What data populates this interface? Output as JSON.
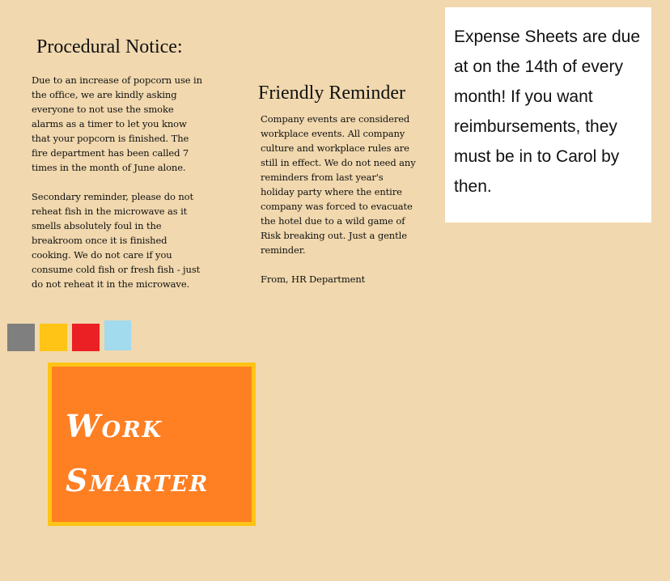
{
  "notice": {
    "title": "Procedural Notice:",
    "paragraphs": [
      "Due to an increase of popcorn use in\nthe office, we are kindly asking\neveryone to not use the smoke\nalarms as a timer to let you know\nthat your popcorn is finished. The\nfire department has been called 7\ntimes in the month of June alone.",
      "Secondary reminder, please do not\nreheat fish in the microwave as it\nsmells absolutely foul in the\nbreakroom once it is finished\ncooking. We do not care if you\nconsume cold fish or fresh fish - just\ndo not reheat it in the microwave."
    ]
  },
  "reminder": {
    "title": "Friendly Reminder",
    "body": "Company events are considered\nworkplace events. All company\nculture and workplace rules are\nstill in effect. We do not need any\nreminders from last year's\nholiday party where the entire\ncompany was forced to evacuate\nthe hotel due to a wild game of\nRisk breaking out. Just a gentle\nreminder.",
    "signature": "From, HR Department"
  },
  "expense_card": {
    "text": "Expense Sheets are due at on the 14th of every month! If you want reimbursements, they must be in to Carol by then."
  },
  "swatches": {
    "colors": [
      "#7f7f7f",
      "#ffc416",
      "#eb2024",
      "#a2daee"
    ]
  },
  "poster": {
    "line_1": "Work",
    "line_2": "Smarter",
    "background_color": "#ff7f23",
    "border_color": "#ffc416",
    "text_color": "#ffffff"
  },
  "page": {
    "background_color": "#f1d8ae"
  }
}
